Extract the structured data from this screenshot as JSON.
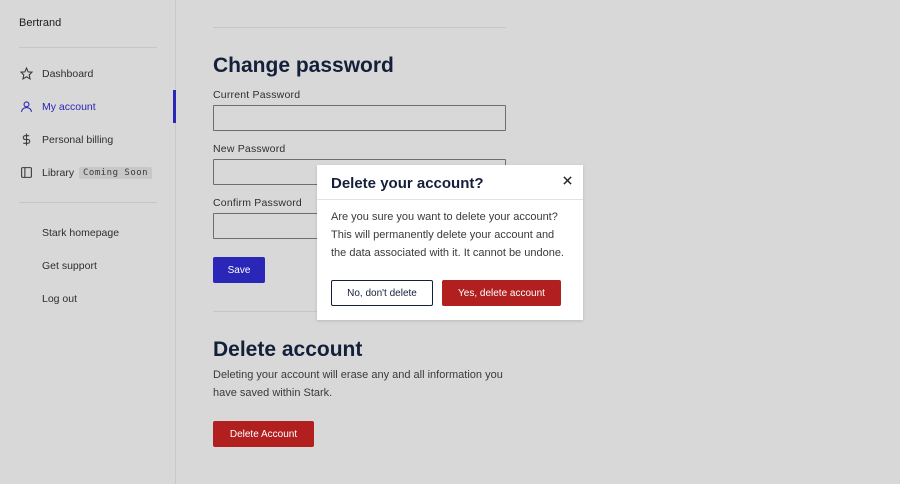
{
  "sidebar": {
    "brand": "Bertrand",
    "nav": [
      {
        "label": "Dashboard",
        "icon": "star-icon"
      },
      {
        "label": "My account",
        "icon": "user-icon",
        "active": true
      },
      {
        "label": "Personal billing",
        "icon": "dollar-icon"
      },
      {
        "label": "Library",
        "icon": "book-icon",
        "badge": "Coming Soon"
      }
    ],
    "links": [
      "Stark homepage",
      "Get support",
      "Log out"
    ],
    "accent": "#2a26b8"
  },
  "change_password": {
    "title": "Change password",
    "current_label": "Current Password",
    "new_label": "New Password",
    "confirm_label": "Confirm Password",
    "save_label": "Save"
  },
  "delete_account": {
    "title": "Delete account",
    "description": "Deleting your account will erase any and all information you have saved within Stark.",
    "button_label": "Delete Account",
    "danger_color": "#b11f1f"
  },
  "modal": {
    "title": "Delete your account?",
    "body": "Are you sure you want to delete your account? This will permanently delete your account and the data associated with it. It cannot be undone.",
    "cancel_label": "No, don't delete",
    "confirm_label": "Yes, delete account",
    "close_icon": "close-icon"
  }
}
